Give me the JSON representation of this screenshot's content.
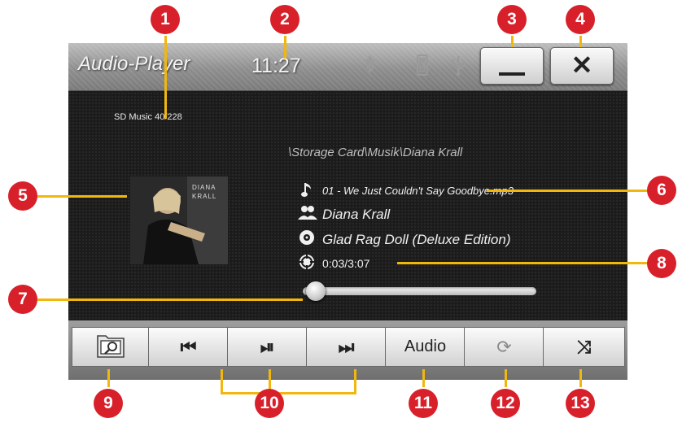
{
  "header": {
    "app_title": "Audio-Player",
    "clock": "11:27",
    "status_icons": [
      "bluetooth-icon",
      "ipod-icon",
      "usb-icon"
    ],
    "minimize_icon": "minimize-icon",
    "close_glyph": "✕"
  },
  "source_label": "SD Music 40/228",
  "path": "\\Storage Card\\Musik\\Diana Krall",
  "track": {
    "file": "01 - We Just Couldn't Say Goodbye.mp3",
    "artist": "Diana Krall",
    "album": "Glad Rag Doll (Deluxe Edition)",
    "time": "0:03/3:07",
    "cover_text": "DIANA KRALL"
  },
  "progress": {
    "elapsed_seconds": 3,
    "total_seconds": 187
  },
  "toolbar": {
    "browse_icon": "folder-search-icon",
    "prev_glyph": "⏮",
    "play_pause_glyph": "⏯",
    "next_glyph": "⏭",
    "audio_label": "Audio",
    "repeat_glyph": "⟳",
    "shuffle_glyph": "⤨"
  },
  "callouts": [
    "1",
    "2",
    "3",
    "4",
    "5",
    "6",
    "7",
    "8",
    "9",
    "10",
    "11",
    "12",
    "13"
  ],
  "colors": {
    "callout_red": "#d8202a",
    "callout_line": "#f1b70f",
    "screen_bg": "#1b1b1b"
  }
}
